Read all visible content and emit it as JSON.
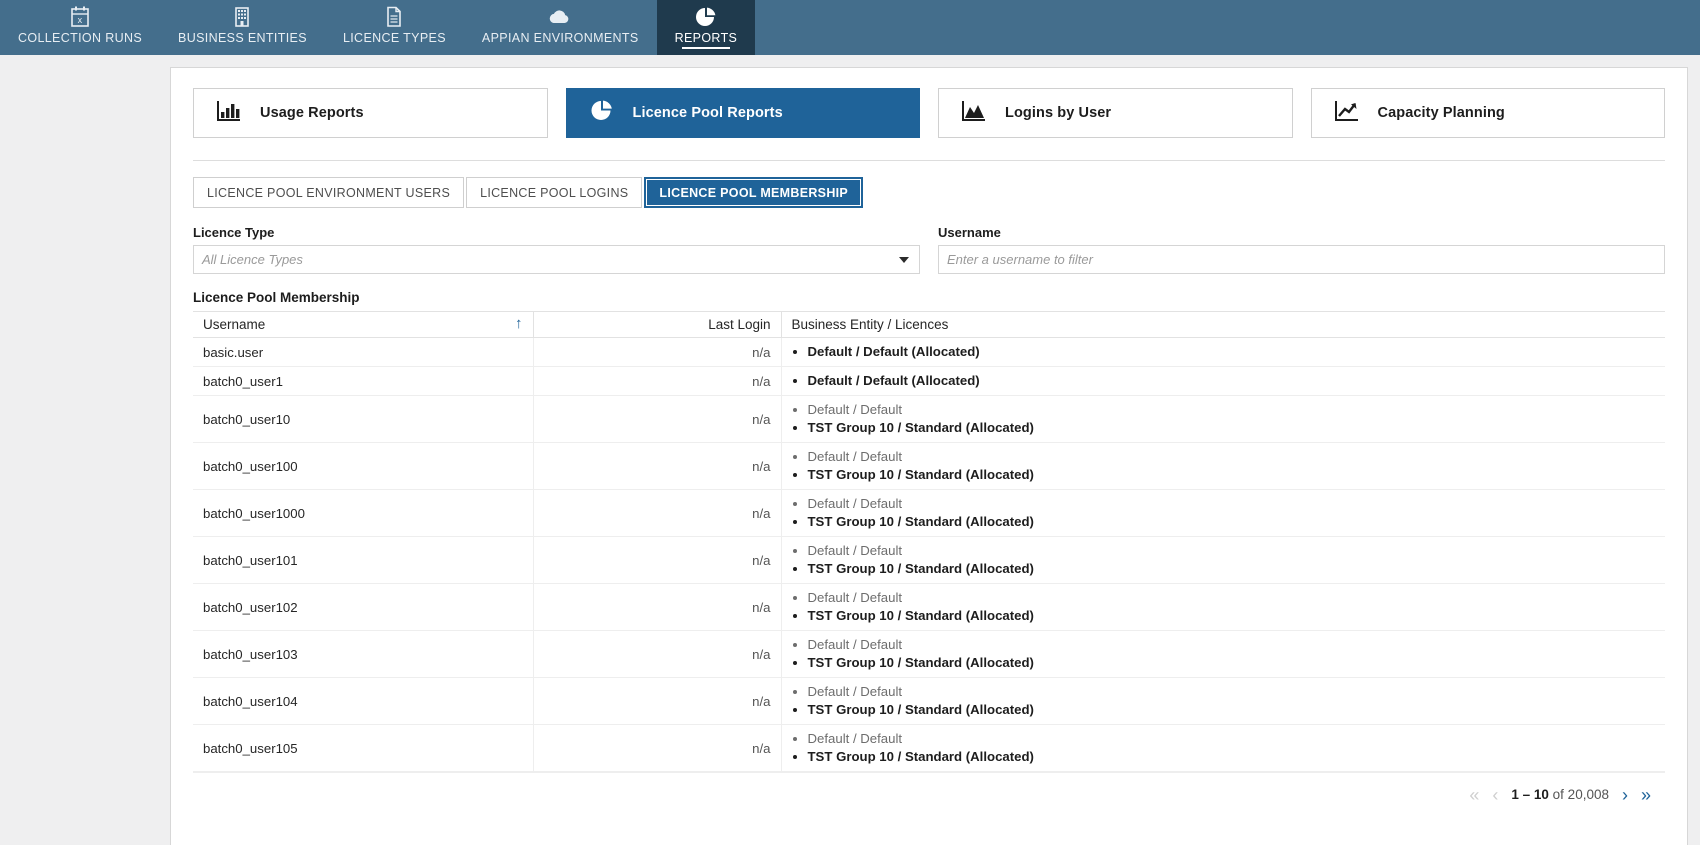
{
  "topnav": {
    "items": [
      {
        "label": "COLLECTION RUNS",
        "icon": "calendar-x-icon",
        "active": false
      },
      {
        "label": "BUSINESS ENTITIES",
        "icon": "building-icon",
        "active": false
      },
      {
        "label": "LICENCE TYPES",
        "icon": "document-icon",
        "active": false
      },
      {
        "label": "APPIAN ENVIRONMENTS",
        "icon": "cloud-icon",
        "active": false
      },
      {
        "label": "REPORTS",
        "icon": "pie-chart-icon",
        "active": true
      }
    ]
  },
  "report_cards": [
    {
      "label": "Usage Reports",
      "icon": "bar-chart-icon",
      "active": false
    },
    {
      "label": "Licence Pool Reports",
      "icon": "pie-chart-icon",
      "active": true
    },
    {
      "label": "Logins by User",
      "icon": "area-chart-icon",
      "active": false
    },
    {
      "label": "Capacity Planning",
      "icon": "trend-up-icon",
      "active": false
    }
  ],
  "subtabs": [
    {
      "label": "LICENCE POOL ENVIRONMENT USERS",
      "active": false
    },
    {
      "label": "LICENCE POOL LOGINS",
      "active": false
    },
    {
      "label": "LICENCE POOL MEMBERSHIP",
      "active": true
    }
  ],
  "filters": {
    "licence_type": {
      "label": "Licence Type",
      "value": "",
      "placeholder": "All Licence Types"
    },
    "username": {
      "label": "Username",
      "value": "",
      "placeholder": "Enter a username to filter"
    }
  },
  "table": {
    "title": "Licence Pool Membership",
    "columns": [
      "Username",
      "Last Login",
      "Business Entity / Licences"
    ],
    "sort": {
      "column": "Username",
      "direction": "asc",
      "glyph": "↑"
    },
    "rows": [
      {
        "username": "basic.user",
        "last_login": "n/a",
        "licences": [
          {
            "text": "Default / Default (Allocated)",
            "allocated": true
          }
        ]
      },
      {
        "username": "batch0_user1",
        "last_login": "n/a",
        "licences": [
          {
            "text": "Default / Default (Allocated)",
            "allocated": true
          }
        ]
      },
      {
        "username": "batch0_user10",
        "last_login": "n/a",
        "licences": [
          {
            "text": "Default / Default",
            "allocated": false
          },
          {
            "text": "TST Group 10 / Standard (Allocated)",
            "allocated": true
          }
        ]
      },
      {
        "username": "batch0_user100",
        "last_login": "n/a",
        "licences": [
          {
            "text": "Default / Default",
            "allocated": false
          },
          {
            "text": "TST Group 10 / Standard (Allocated)",
            "allocated": true
          }
        ]
      },
      {
        "username": "batch0_user1000",
        "last_login": "n/a",
        "licences": [
          {
            "text": "Default / Default",
            "allocated": false
          },
          {
            "text": "TST Group 10 / Standard (Allocated)",
            "allocated": true
          }
        ]
      },
      {
        "username": "batch0_user101",
        "last_login": "n/a",
        "licences": [
          {
            "text": "Default / Default",
            "allocated": false
          },
          {
            "text": "TST Group 10 / Standard (Allocated)",
            "allocated": true
          }
        ]
      },
      {
        "username": "batch0_user102",
        "last_login": "n/a",
        "licences": [
          {
            "text": "Default / Default",
            "allocated": false
          },
          {
            "text": "TST Group 10 / Standard (Allocated)",
            "allocated": true
          }
        ]
      },
      {
        "username": "batch0_user103",
        "last_login": "n/a",
        "licences": [
          {
            "text": "Default / Default",
            "allocated": false
          },
          {
            "text": "TST Group 10 / Standard (Allocated)",
            "allocated": true
          }
        ]
      },
      {
        "username": "batch0_user104",
        "last_login": "n/a",
        "licences": [
          {
            "text": "Default / Default",
            "allocated": false
          },
          {
            "text": "TST Group 10 / Standard (Allocated)",
            "allocated": true
          }
        ]
      },
      {
        "username": "batch0_user105",
        "last_login": "n/a",
        "licences": [
          {
            "text": "Default / Default",
            "allocated": false
          },
          {
            "text": "TST Group 10 / Standard (Allocated)",
            "allocated": true
          }
        ]
      }
    ]
  },
  "pager": {
    "first_glyph": "«",
    "prev_glyph": "‹",
    "next_glyph": "›",
    "last_glyph": "»",
    "range_start": "1",
    "range_end": "10",
    "range_text": "1 – 10",
    "of_text": "of 20,008",
    "total": "20,008",
    "first_enabled": false,
    "prev_enabled": false,
    "next_enabled": true,
    "last_enabled": true
  },
  "colors": {
    "nav_bg": "#446e8c",
    "nav_active_bg": "#1f3a4d",
    "accent": "#1f6399",
    "page_bg": "#efeff0"
  }
}
